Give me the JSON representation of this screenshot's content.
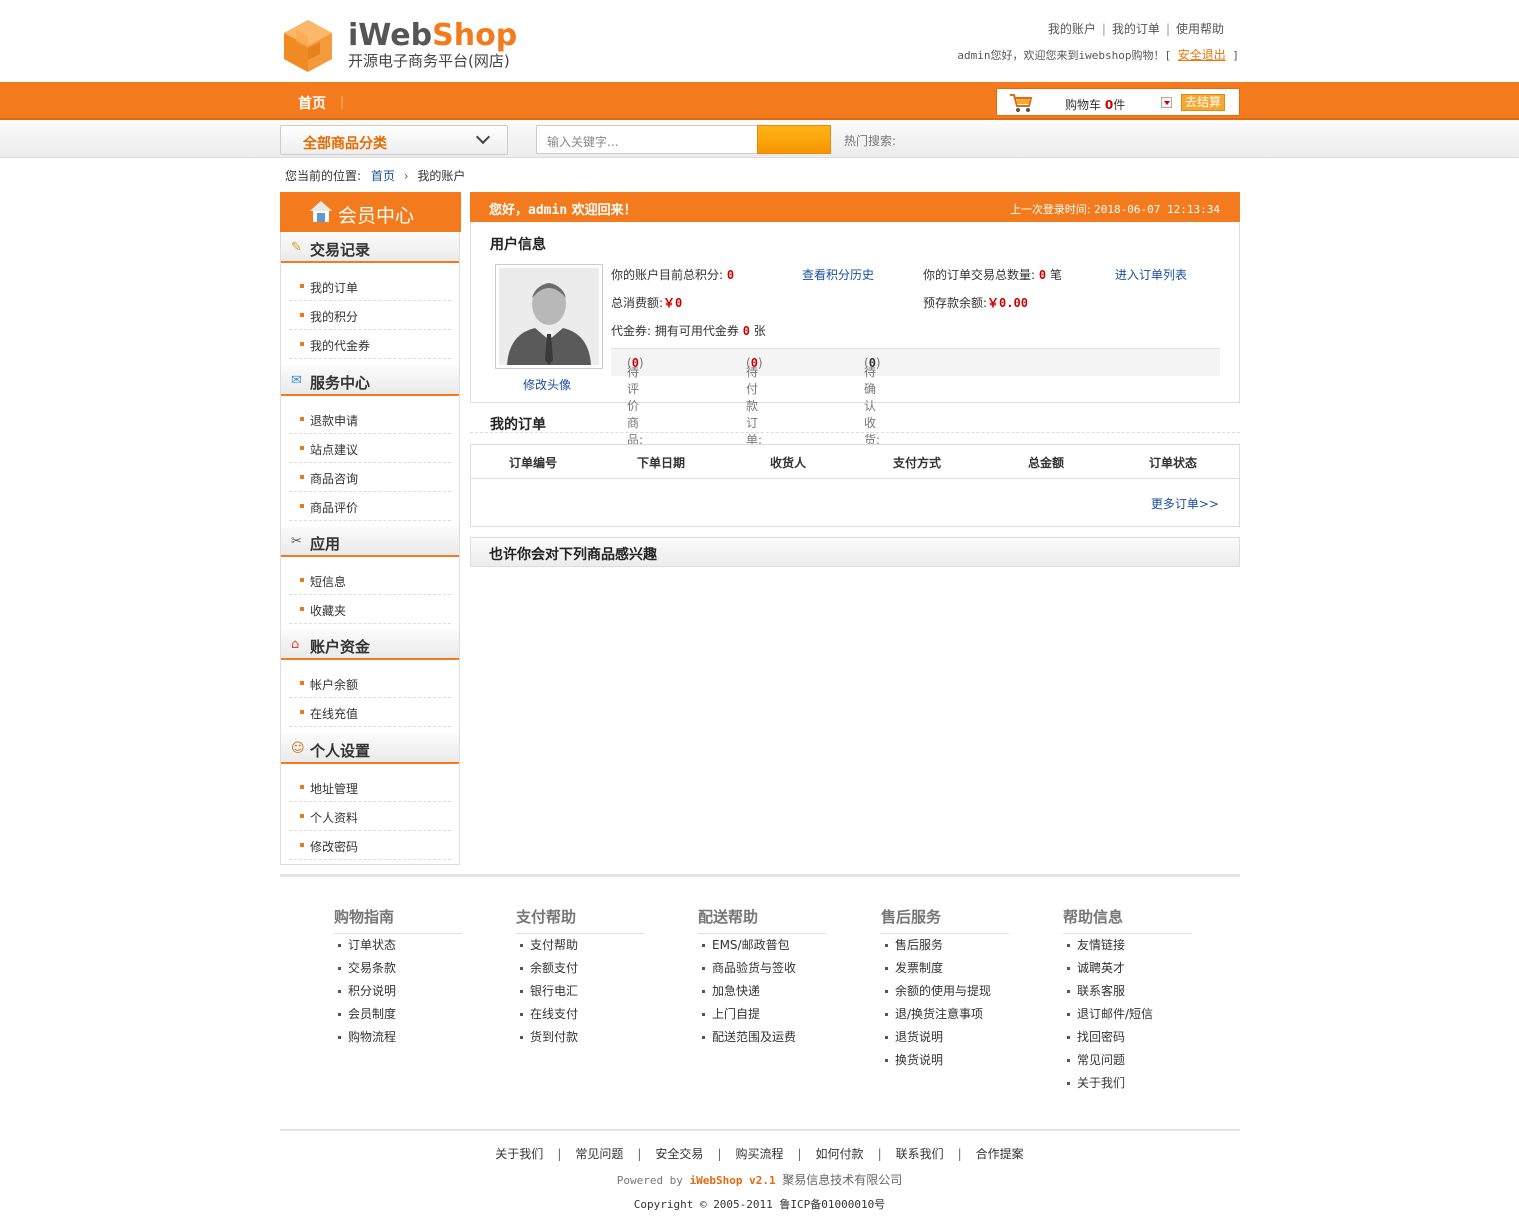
{
  "header": {
    "logo_brand_a": "iWeb",
    "logo_brand_b": "Shop",
    "logo_tagline": "开源电子商务平台(网店)",
    "top_links": [
      "我的账户",
      "我的订单",
      "使用帮助"
    ],
    "welcome_prefix": "admin您好，欢迎您来到iwebshop购物！[",
    "logout": "安全退出",
    "welcome_suffix": "]"
  },
  "nav": {
    "home": "首页",
    "cart_label": "购物车",
    "cart_count": "0",
    "cart_unit": "件",
    "checkout": "去结算"
  },
  "search": {
    "category_select": "全部商品分类",
    "placeholder": "输入关键字...",
    "hot_label": "热门搜索:"
  },
  "breadcrumb": {
    "label": "您当前的位置:",
    "home": "首页",
    "current": "我的账户"
  },
  "sidebar": {
    "title": "会员中心",
    "sections": [
      {
        "title": "交易记录",
        "items": [
          "我的订单",
          "我的积分",
          "我的代金券"
        ]
      },
      {
        "title": "服务中心",
        "items": [
          "退款申请",
          "站点建议",
          "商品咨询",
          "商品评价"
        ]
      },
      {
        "title": "应用",
        "items": [
          "短信息",
          "收藏夹"
        ]
      },
      {
        "title": "账户资金",
        "items": [
          "帐户余额",
          "在线充值"
        ]
      },
      {
        "title": "个人设置",
        "items": [
          "地址管理",
          "个人资料",
          "修改密码"
        ]
      }
    ]
  },
  "main": {
    "welcome_a": "您好，",
    "welcome_user": "admin",
    "welcome_b": " 欢迎回来！",
    "last_login_label": "上一次登录时间:",
    "last_login_time": "2018-06-07 12:13:34",
    "user_info_title": "用户信息",
    "edit_avatar": "修改头像",
    "points_label": "你的账户目前总积分:",
    "points_value": "0",
    "points_history": "查看积分历史",
    "orders_count_label": "你的订单交易总数量:",
    "orders_count_value": "0",
    "orders_count_unit": "笔",
    "order_list_link": "进入订单列表",
    "spend_label": "总消费额:",
    "spend_value": "￥0",
    "balance_label": "预存款余额:",
    "balance_value": "￥0.00",
    "voucher_a": "代金券: 拥有可用代金券",
    "voucher_value": "0",
    "voucher_unit": "张",
    "pending_review_label": "待评价商品:",
    "pending_review_value": "0",
    "pending_pay_label": "待付款订单:",
    "pending_pay_value": "0",
    "pending_confirm_label": "待确认收货:",
    "pending_confirm_value": "0",
    "orders_title": "我的订单",
    "order_columns": [
      "订单编号",
      "下单日期",
      "收货人",
      "支付方式",
      "总金额",
      "订单状态"
    ],
    "more_orders": "更多订单>>",
    "interest_title": "也许你会对下列商品感兴趣"
  },
  "footer": {
    "columns": [
      {
        "title": "购物指南",
        "items": [
          "订单状态",
          "交易条款",
          "积分说明",
          "会员制度",
          "购物流程"
        ]
      },
      {
        "title": "支付帮助",
        "items": [
          "支付帮助",
          "余额支付",
          "银行电汇",
          "在线支付",
          "货到付款"
        ]
      },
      {
        "title": "配送帮助",
        "items": [
          "EMS/邮政普包",
          "商品验货与签收",
          "加急快递",
          "上门自提",
          "配送范围及运费"
        ]
      },
      {
        "title": "售后服务",
        "items": [
          "售后服务",
          "发票制度",
          "余额的使用与提现",
          "退/换货注意事项",
          "退货说明",
          "换货说明"
        ]
      },
      {
        "title": "帮助信息",
        "items": [
          "友情链接",
          "诚聘英才",
          "联系客服",
          "退订邮件/短信",
          "找回密码",
          "常见问题",
          "关于我们"
        ]
      }
    ],
    "bottom_links": [
      "关于我们",
      "常见问题",
      "安全交易",
      "购买流程",
      "如何付款",
      "联系我们",
      "合作提案"
    ],
    "powered_a": "Powered by",
    "powered_brand": "iWebShop v2.1",
    "powered_company": "聚易信息技术有限公司",
    "copyright": "Copyright © 2005-2011 鲁ICP备01000010号"
  },
  "colors": {
    "accent": "#f37b1d",
    "link": "#1a4fa0",
    "value_red": "#cc0000"
  }
}
